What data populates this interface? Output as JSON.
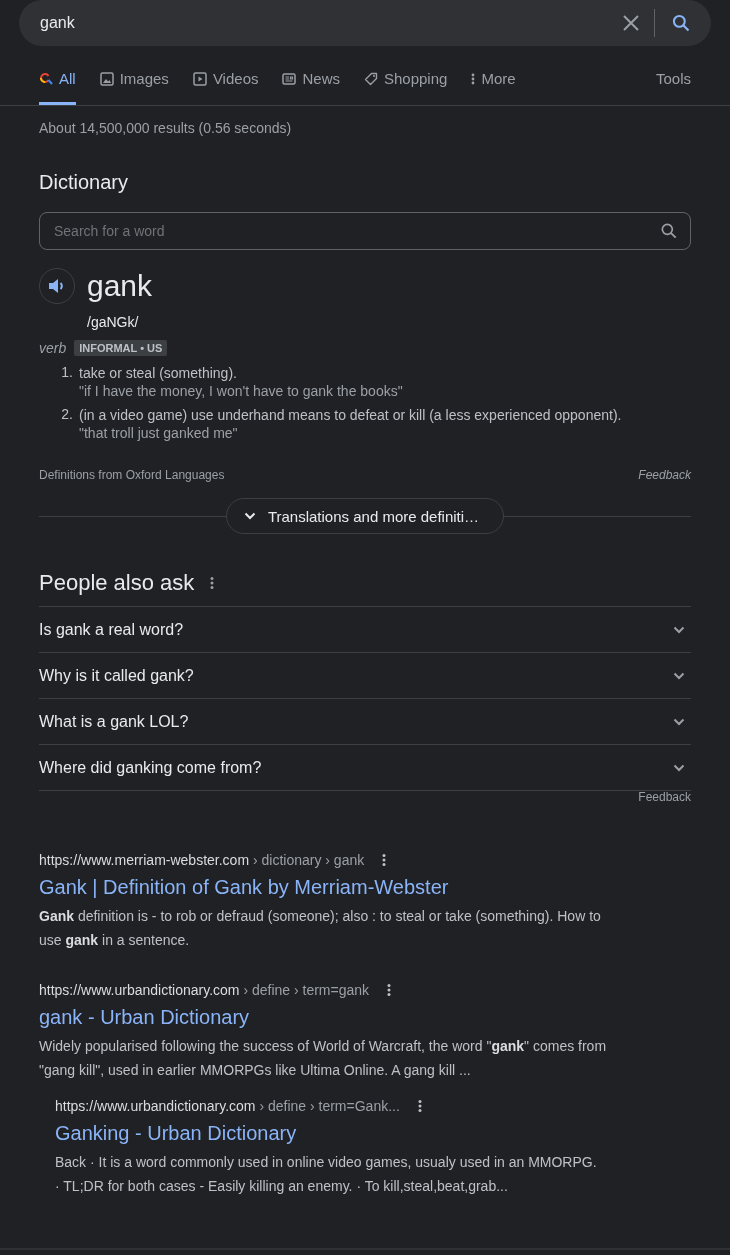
{
  "search": {
    "value": "gank"
  },
  "tabs": [
    {
      "label": "All",
      "kind": "all",
      "selected": true
    },
    {
      "label": "Images",
      "kind": "images",
      "selected": false
    },
    {
      "label": "Videos",
      "kind": "videos",
      "selected": false
    },
    {
      "label": "News",
      "kind": "news",
      "selected": false
    },
    {
      "label": "Shopping",
      "kind": "shopping",
      "selected": false
    },
    {
      "label": "More",
      "kind": "more",
      "selected": false
    }
  ],
  "tools": "Tools",
  "result_stats": "About 14,500,000 results (0.56 seconds)",
  "dictionary": {
    "heading": "Dictionary",
    "search_placeholder": "Search for a word",
    "word": "gank",
    "phonetic": "/gaNGk/",
    "part_of_speech": "verb",
    "usage_label": "INFORMAL • US",
    "definitions": [
      {
        "number": "1.",
        "text": "take or steal (something).",
        "example": "\"if I have the money, I won't have to gank the books\""
      },
      {
        "number": "2.",
        "text": "(in a video game) use underhand means to defeat or kill (a less experienced opponent).",
        "example": "\"that troll just ganked me\""
      }
    ],
    "source": "Definitions from Oxford Languages",
    "feedback": "Feedback",
    "more_button": "Translations and more definiti…"
  },
  "people_also_ask": {
    "heading": "People also ask",
    "questions": [
      {
        "text": "Is gank a real word?",
        "expanded": false
      },
      {
        "text": "Why is it called gank?",
        "expanded": false
      },
      {
        "text": "What is a gank LOL?",
        "expanded": false
      },
      {
        "text": "Where did ganking come from?",
        "expanded": false
      }
    ],
    "feedback": "Feedback"
  },
  "results": [
    {
      "kind": "main",
      "url": "https://www.merriam-webster.com",
      "path": "› dictionary › gank",
      "title": "Gank | Definition of Gank by Merriam-Webster",
      "snippet": "**Gank** definition is - to rob or defraud (someone); also : to steal or take (something). How to use **gank** in a sentence."
    },
    {
      "kind": "main",
      "url": "https://www.urbandictionary.com",
      "path": "› define › term=gank",
      "title": "gank - Urban Dictionary",
      "snippet": "Widely popularised following the success of World of Warcraft, the word \"**gank**\" comes from \"gang kill\", used in earlier MMORPGs like Ultima Online. A gang kill ..."
    },
    {
      "kind": "sub",
      "url": "https://www.urbandictionary.com",
      "path": "› define › term=Gank...",
      "title": "Ganking - Urban Dictionary",
      "snippet": "Back · It is a word commonly used in online video games, usualy used in an MMORPG. · TL;DR for both cases - Easily killing an enemy. · To kill,steal,beat,grab..."
    }
  ]
}
